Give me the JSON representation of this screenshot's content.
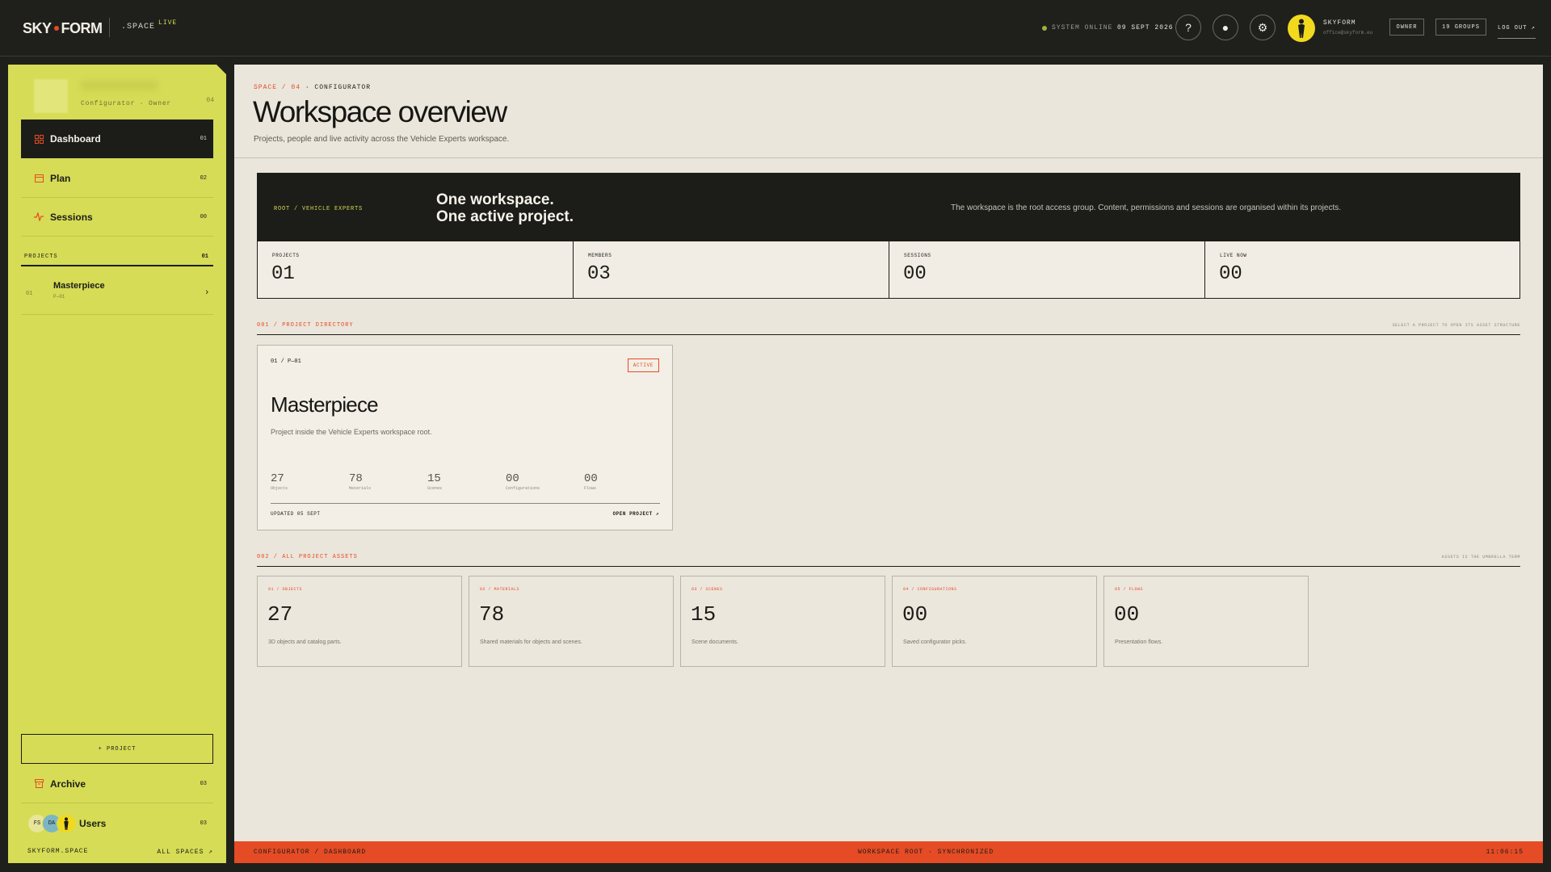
{
  "topbar": {
    "logo_left": "SKY",
    "logo_right": "FORM",
    "space": ".SPACE",
    "live": "LIVE",
    "status": "SYSTEM ONLINE",
    "date": "09 SEPT 2026",
    "help_icon": "?",
    "dot_icon": "●",
    "settings_icon": "⚙",
    "user_name": "SKYFORM",
    "user_email": "office@skyform.eu",
    "role": "OWNER",
    "groups": "19 GROUPS",
    "logout": "LOG OUT ↗",
    "colors": {
      "brand_dot": "#e54b24",
      "status_dot": "#9fb23a",
      "avatar": "#f2d91e"
    }
  },
  "sidebar": {
    "workspace_role": "Configurator · Owner",
    "workspace_num": "04",
    "nav": [
      {
        "label": "Dashboard",
        "num": "01",
        "icon": "grid-icon"
      },
      {
        "label": "Plan",
        "num": "02",
        "icon": "calendar-icon"
      },
      {
        "label": "Sessions",
        "num": "00",
        "icon": "activity-icon"
      }
    ],
    "projects_label": "PROJECTS",
    "projects_count": "01",
    "project": {
      "num": "01",
      "title": "Masterpiece",
      "code": "P—01"
    },
    "add_project": "+ PROJECT",
    "archive": {
      "label": "Archive",
      "num": "03"
    },
    "users": {
      "label": "Users",
      "num": "03",
      "initials": [
        "FS",
        "DA"
      ]
    },
    "footer_left": "SKYFORM.SPACE",
    "footer_right": "ALL SPACES ↗",
    "colors": {
      "bg": "#d6dc55",
      "active": "#1c1d19",
      "icon": "#e54b24"
    }
  },
  "main": {
    "breadcrumb_accent": "SPACE / 04",
    "breadcrumb_rest": " · CONFIGURATOR",
    "title": "Workspace overview",
    "subtitle": "Projects, people and live activity across the Vehicle Experts workspace.",
    "hero": {
      "tag": "ROOT / VEHICLE EXPERTS",
      "line1": "One workspace.",
      "line2": "One active project.",
      "desc": "The workspace is the root access group. Content, permissions and sessions are organised within its projects."
    },
    "stats": [
      {
        "label": "PROJECTS",
        "value": "01"
      },
      {
        "label": "MEMBERS",
        "value": "03"
      },
      {
        "label": "SESSIONS",
        "value": "00"
      },
      {
        "label": "LIVE NOW",
        "value": "00"
      }
    ],
    "directory": {
      "label": "001 / PROJECT DIRECTORY",
      "hint": "SELECT A PROJECT TO OPEN ITS ASSET STRUCTURE"
    },
    "project_card": {
      "code": "01 / P—01",
      "badge": "ACTIVE",
      "title": "Masterpiece",
      "desc": "Project inside the Vehicle Experts workspace root.",
      "stats": [
        {
          "value": "27",
          "label": "Objects"
        },
        {
          "value": "78",
          "label": "Materials"
        },
        {
          "value": "15",
          "label": "Scenes"
        },
        {
          "value": "00",
          "label": "Configurations"
        },
        {
          "value": "00",
          "label": "Flows"
        }
      ],
      "updated": "UPDATED 05 SEPT",
      "open": "OPEN PROJECT ↗"
    },
    "assets_head": {
      "label": "002 / ALL PROJECT ASSETS",
      "hint": "ASSETS IS THE UMBRELLA TERM"
    },
    "assets": [
      {
        "label": "01 / OBJECTS",
        "value": "27",
        "desc": "3D objects and catalog parts."
      },
      {
        "label": "02 / MATERIALS",
        "value": "78",
        "desc": "Shared materials for objects and scenes."
      },
      {
        "label": "03 / SCENES",
        "value": "15",
        "desc": "Scene documents."
      },
      {
        "label": "04 / CONFIGURATIONS",
        "value": "00",
        "desc": "Saved configurator picks."
      },
      {
        "label": "05 / FLOWS",
        "value": "00",
        "desc": "Presentation flows."
      }
    ]
  },
  "footer": {
    "left": "CONFIGURATOR / DASHBOARD",
    "center": "WORKSPACE ROOT · SYNCHRONIZED",
    "right": "11:06:15",
    "color": "#e54b24"
  }
}
